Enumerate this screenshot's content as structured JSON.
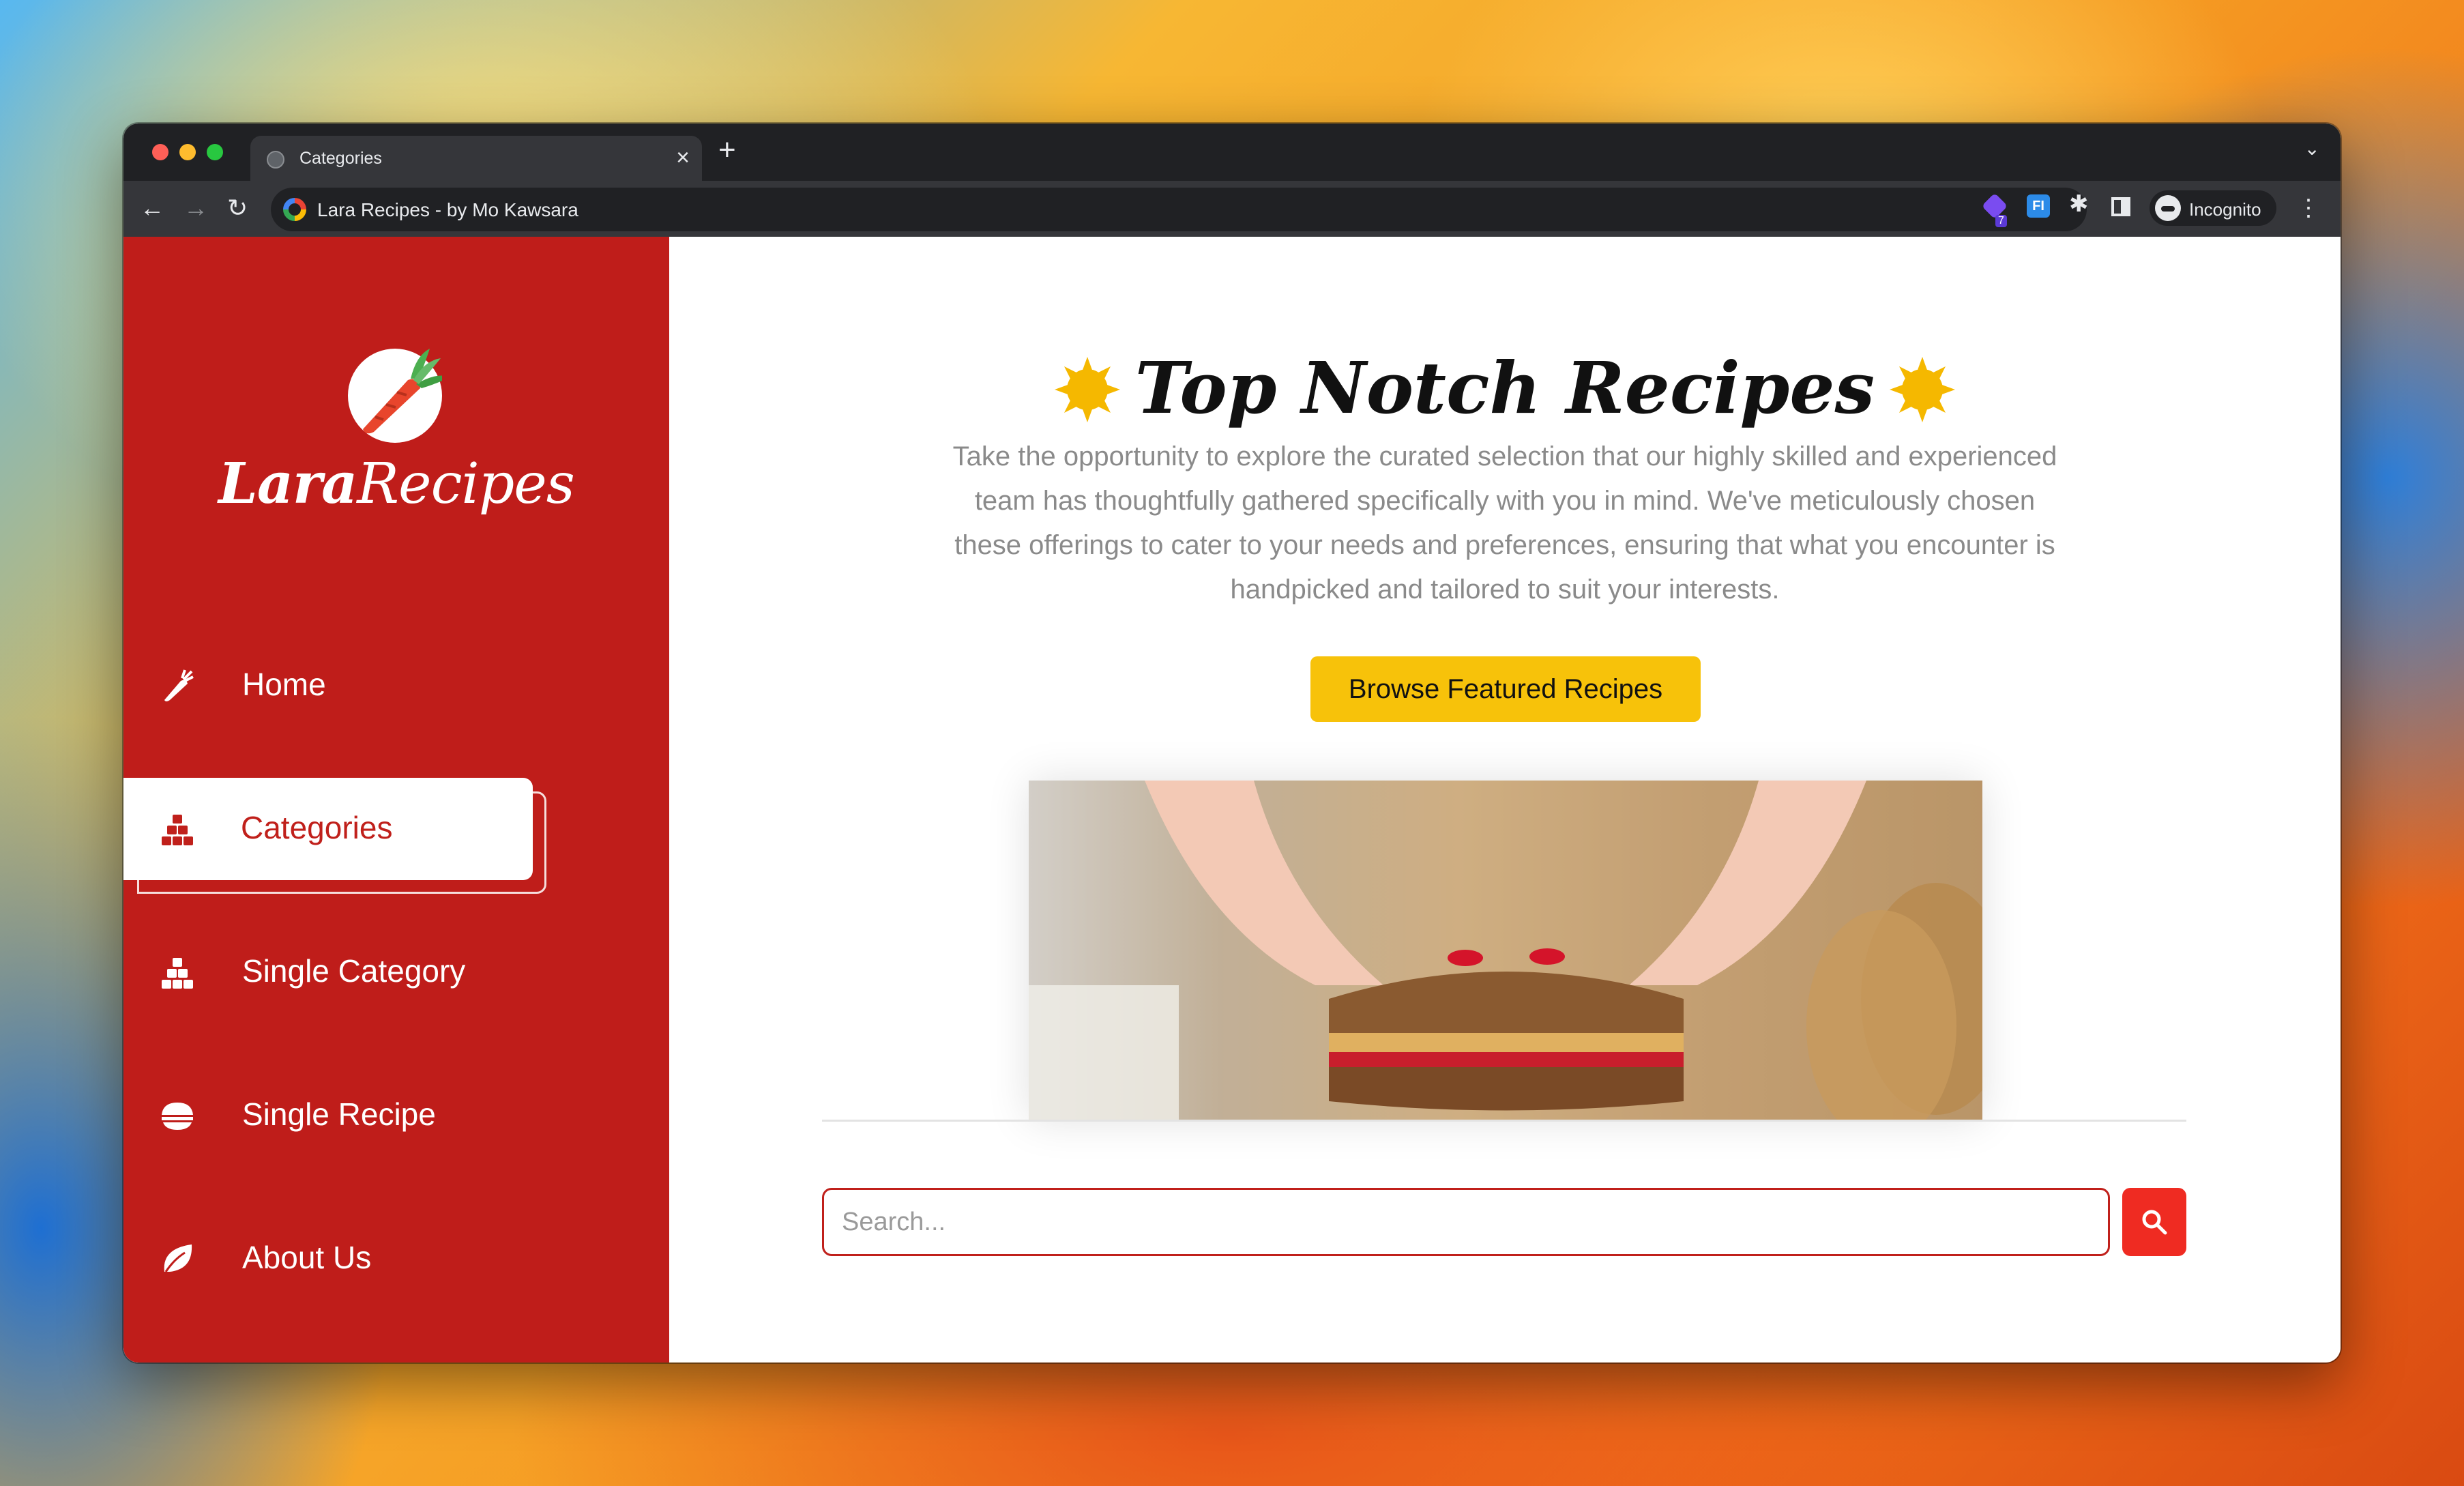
{
  "browser": {
    "tab_title": "Categories",
    "tab_close": "×",
    "new_tab": "+",
    "tab_list": "⌄",
    "back": "←",
    "forward": "→",
    "reload": "↻",
    "address": "Lara Recipes - by Mo Kawsara",
    "extensions": [
      {
        "name": "purple-extension-icon",
        "badge": "7"
      },
      {
        "name": "fi-extension-icon",
        "label": "FI"
      },
      {
        "name": "puzzle-icon"
      },
      {
        "name": "side-panel-icon"
      }
    ],
    "profile_label": "Incognito",
    "menu": "⋮"
  },
  "sidebar": {
    "logo_bold": "Lara",
    "logo_regular": "Recipes",
    "items": [
      {
        "label": "Home",
        "icon": "carrot-icon",
        "active": false
      },
      {
        "label": "Categories",
        "icon": "cubes-icon",
        "active": true
      },
      {
        "label": "Single Category",
        "icon": "cubes-icon",
        "active": false
      },
      {
        "label": "Single Recipe",
        "icon": "bowl-icon",
        "active": false
      },
      {
        "label": "About Us",
        "icon": "leaf-icon",
        "active": false
      }
    ]
  },
  "main": {
    "title": "Top Notch Recipes",
    "description": "Take the opportunity to explore the curated selection that our highly skilled and experienced team has thoughtfully gathered specifically with you in mind. We've meticulously chosen these offerings to cater to your needs and preferences, ensuring that what you encounter is handpicked and tailored to suit your interests.",
    "cta_label": "Browse Featured Recipes",
    "search_placeholder": "Search..."
  },
  "colors": {
    "sidebar": "#bf1d1a",
    "accent_yellow": "#f7c20a",
    "search_button": "#ef2b22"
  }
}
